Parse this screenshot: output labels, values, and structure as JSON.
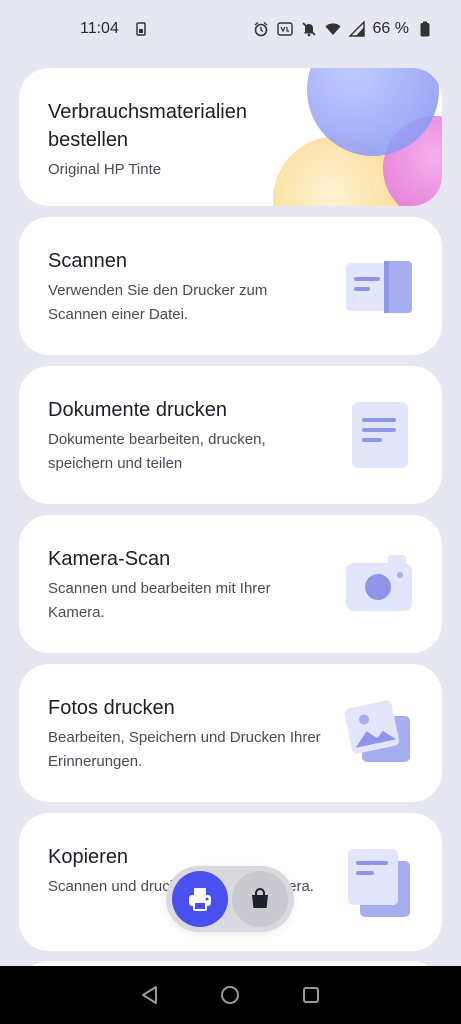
{
  "status": {
    "time": "11:04",
    "battery": "66 %",
    "icons": [
      "sim-icon",
      "alarm-icon",
      "volte-icon",
      "mute-icon",
      "wifi-icon",
      "signal-icon",
      "battery-icon"
    ]
  },
  "cards": [
    {
      "title": "Verbrauchsmaterialien bestellen",
      "subtitle": "Original HP Tinte",
      "icon": "promo-art"
    },
    {
      "title": "Scannen",
      "subtitle": "Verwenden Sie den Drucker zum Scannen einer Datei.",
      "icon": "scanner-icon"
    },
    {
      "title": "Dokumente drucken",
      "subtitle": "Dokumente bearbeiten, drucken, speichern und teilen",
      "icon": "document-icon"
    },
    {
      "title": "Kamera-Scan",
      "subtitle": "Scannen und bearbeiten mit Ihrer Kamera.",
      "icon": "camera-icon"
    },
    {
      "title": "Fotos drucken",
      "subtitle": "Bearbeiten, Speichern und Drucken Ihrer Erinnerungen.",
      "icon": "photo-icon"
    },
    {
      "title": "Kopieren",
      "subtitle": "Scannen und drucken mit Ihrer Kamera.",
      "icon": "copy-icon"
    }
  ],
  "fab": {
    "print_icon": "printer-icon",
    "shop_icon": "shopping-bag-icon"
  },
  "nav": {
    "icons": [
      "back-icon",
      "home-icon",
      "recents-icon"
    ]
  },
  "colors": {
    "accent": "#4a4ff0",
    "background": "#e7e7f1",
    "card": "#ffffff"
  }
}
